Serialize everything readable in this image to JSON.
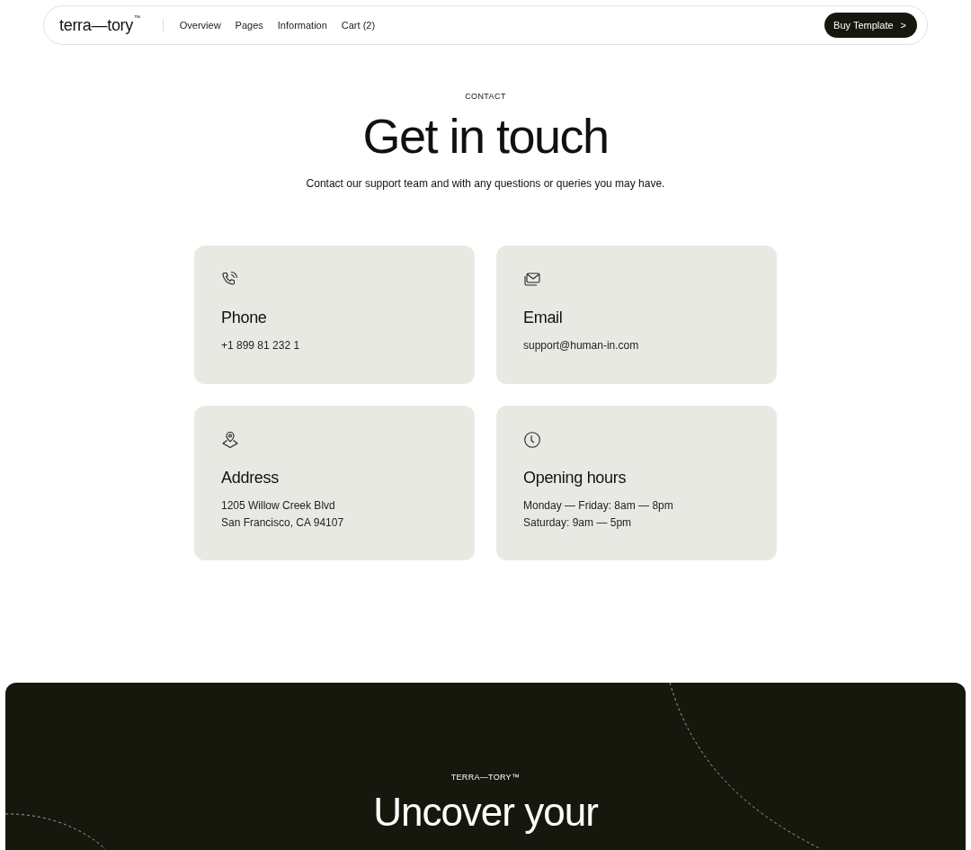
{
  "nav": {
    "logo": "terra—tory",
    "logo_mark": "™",
    "links": [
      "Overview",
      "Pages",
      "Information",
      "Cart (2)"
    ],
    "button": "Buy Template",
    "button_icon": ">"
  },
  "hero": {
    "eyebrow": "CONTACT",
    "title": "Get in touch",
    "subtitle": "Contact our support team and with any questions or queries you may have."
  },
  "cards": [
    {
      "kind": "phone",
      "title": "Phone",
      "lines": [
        "+1 899 81 232 1"
      ]
    },
    {
      "kind": "email",
      "title": "Email",
      "lines": [
        "support@human-in.com"
      ]
    },
    {
      "kind": "address",
      "title": "Address",
      "lines": [
        "1205 Willow Creek Blvd",
        "San Francisco, CA 94107"
      ]
    },
    {
      "kind": "hours",
      "title": "Opening hours",
      "lines": [
        "Monday — Friday: 8am — 8pm",
        "Saturday: 9am — 5pm"
      ]
    }
  ],
  "footer": {
    "eyebrow": "TERRA—TORY™",
    "title": "Uncover your"
  }
}
